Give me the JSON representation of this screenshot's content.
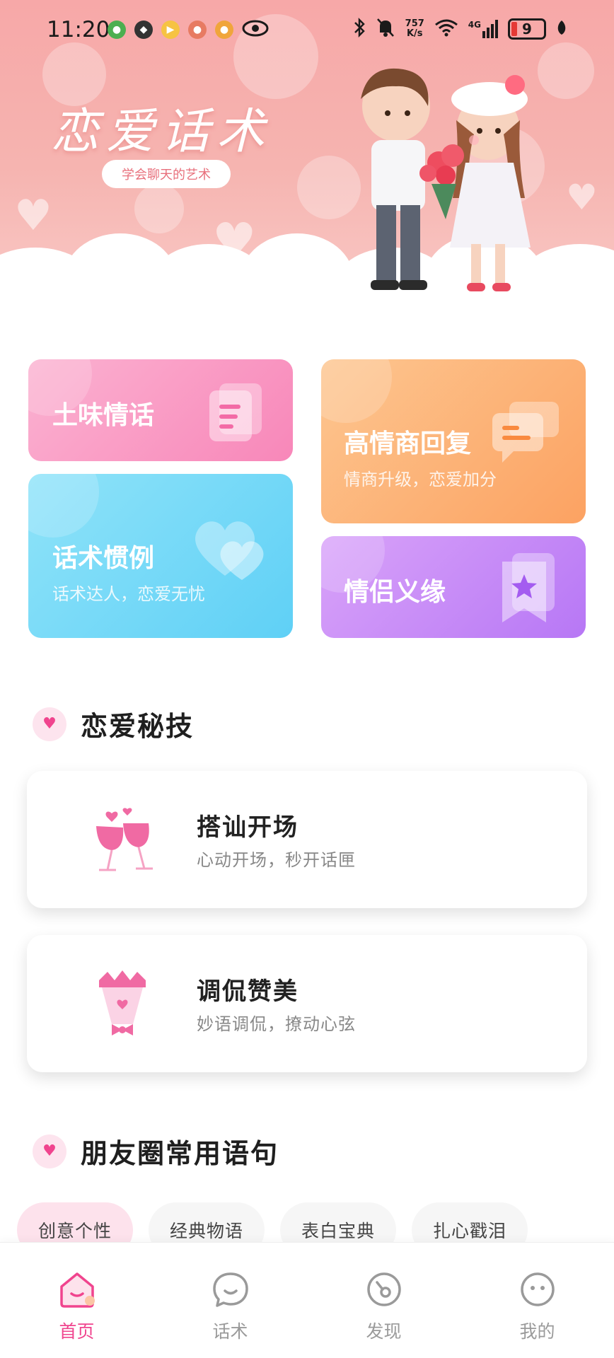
{
  "status_bar": {
    "time": "11:20",
    "net_speed_value": "757",
    "net_speed_unit": "K/s",
    "signal_label": "4G",
    "battery_level": "9"
  },
  "hero": {
    "title": "恋爱话术",
    "subtitle": "学会聊天的艺术"
  },
  "quick_cards": {
    "tuwei": {
      "title": "土味情话"
    },
    "gaoqingshang": {
      "title": "高情商回复",
      "subtitle": "情商升级，恋爱加分"
    },
    "huashu": {
      "title": "话术惯例",
      "subtitle": "话术达人，恋爱无忧"
    },
    "qinglv": {
      "title": "情侣义缘"
    }
  },
  "love_tips": {
    "title": "恋爱秘技",
    "items": [
      {
        "title": "搭讪开场",
        "subtitle": "心动开场，秒开话匣"
      },
      {
        "title": "调侃赞美",
        "subtitle": "妙语调侃，撩动心弦"
      }
    ]
  },
  "moments": {
    "title": "朋友圈常用语句",
    "chips": [
      "创意个性",
      "经典物语",
      "表白宝典",
      "扎心戳泪"
    ],
    "active_chip": "创意个性"
  },
  "bottom_nav": {
    "items": [
      {
        "label": "首页",
        "icon": "home-icon",
        "active": true
      },
      {
        "label": "话术",
        "icon": "chat-smile-icon",
        "active": false
      },
      {
        "label": "发现",
        "icon": "compass-icon",
        "active": false
      },
      {
        "label": "我的",
        "icon": "face-icon",
        "active": false
      }
    ]
  },
  "colors": {
    "accent_pink": "#f0448e",
    "card_pink": "#f98fc0",
    "card_orange": "#fdb173",
    "card_blue": "#6fd8f7",
    "card_purple": "#c98af6"
  }
}
